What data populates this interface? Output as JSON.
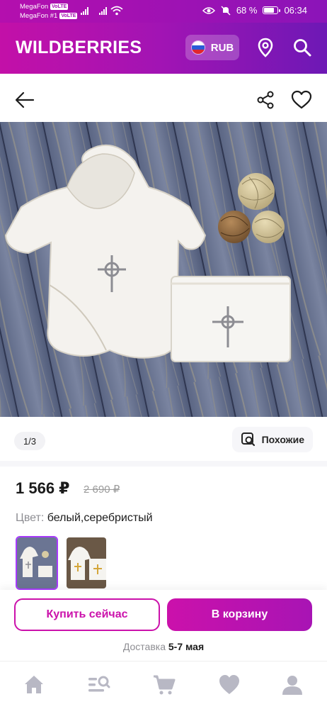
{
  "status_bar": {
    "carrier1": "MegaFon",
    "carrier2": "MegaFon #1",
    "volte": "VoLTE",
    "battery": "68 %",
    "time": "06:34"
  },
  "header": {
    "logo": "WILDBERRIES",
    "currency": "RUB",
    "icons": [
      "location-pin-icon",
      "search-icon"
    ]
  },
  "product_nav": {
    "icons": [
      "back-arrow-icon",
      "share-icon",
      "heart-icon"
    ]
  },
  "gallery": {
    "counter": "1/3",
    "similar_label": "Похожие"
  },
  "product": {
    "price": "1 566 ₽",
    "old_price": "2 690 ₽",
    "color_label": "Цвет:",
    "color_value": "белый,серебристый",
    "variants": [
      "silver-cross",
      "gold-cross"
    ]
  },
  "actions": {
    "buy_now": "Купить сейчас",
    "add_to_cart": "В корзину",
    "delivery_label": "Доставка",
    "delivery_value": "5-7 мая"
  },
  "bottom_nav": {
    "items": [
      "home-icon",
      "catalog-search-icon",
      "cart-icon",
      "favorites-icon",
      "profile-icon"
    ]
  },
  "colors": {
    "brand": "#cb11ab",
    "brand_dark": "#6d18b5",
    "selected_border": "#a73afd"
  }
}
